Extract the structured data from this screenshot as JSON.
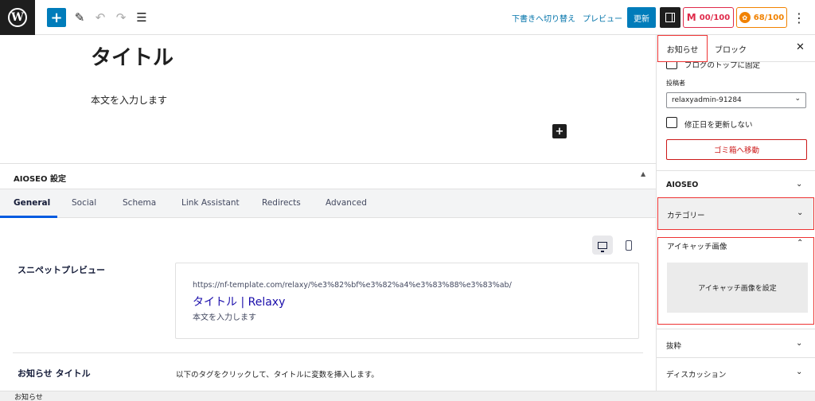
{
  "toolbar": {
    "logo": "W",
    "add": "+",
    "edit_icon": "✎",
    "undo_icon": "↶",
    "redo_icon": "↷",
    "list_icon": "☰",
    "switch_to_draft": "下書きへ切り替え",
    "preview": "プレビュー",
    "update": "更新",
    "score_truseo": "00/100",
    "score_truseo_icon": "M",
    "score_headline": "68/100",
    "score_headline_icon": "✿",
    "more_icon": "⋮"
  },
  "editor": {
    "title": "タイトル",
    "body": "本文を入力します",
    "block_add": "+"
  },
  "aioseo": {
    "header": "AIOSEO 設定",
    "caret": "▲",
    "tabs": [
      "General",
      "Social",
      "Schema",
      "Link Assistant",
      "Redirects",
      "Advanced"
    ],
    "snippet_label": "スニペットプレビュー",
    "snippet": {
      "url": "https://nf-template.com/relaxy/%e3%82%bf%e3%82%a4%e3%83%88%e3%83%ab/",
      "title": "タイトル | Relaxy",
      "description": "本文を入力します"
    },
    "post_title_label": "お知らせ タイトル",
    "post_title_desc": "以下のタグをクリックして、タイトルに変数を挿入します。"
  },
  "sidebar": {
    "tab_post": "お知らせ",
    "tab_block": "ブロック",
    "close": "✕",
    "sticky_label": "ブログのトップに固定",
    "author_label": "投稿者",
    "author_value": "relaxyadmin-91284",
    "select_chevron": "⌄",
    "no_update_date": "修正日を更新しない",
    "trash": "ゴミ箱へ移動",
    "panels": {
      "aioseo": "AIOSEO",
      "category": "カテゴリー",
      "featured_image": "アイキャッチ画像",
      "set_featured_image": "アイキャッチ画像を設定",
      "excerpt": "抜粋",
      "discussion": "ディスカッション"
    },
    "chevron_down": "⌄",
    "chevron_up": "⌃"
  },
  "footer": {
    "breadcrumb": "お知らせ"
  },
  "colors": {
    "accent": "#007cba",
    "wp_dark": "#1e1e1e",
    "truseo_red": "#df2a4a",
    "headline_orange": "#f18200",
    "destructive": "#cc1818",
    "highlight_box": "#ee3333"
  }
}
